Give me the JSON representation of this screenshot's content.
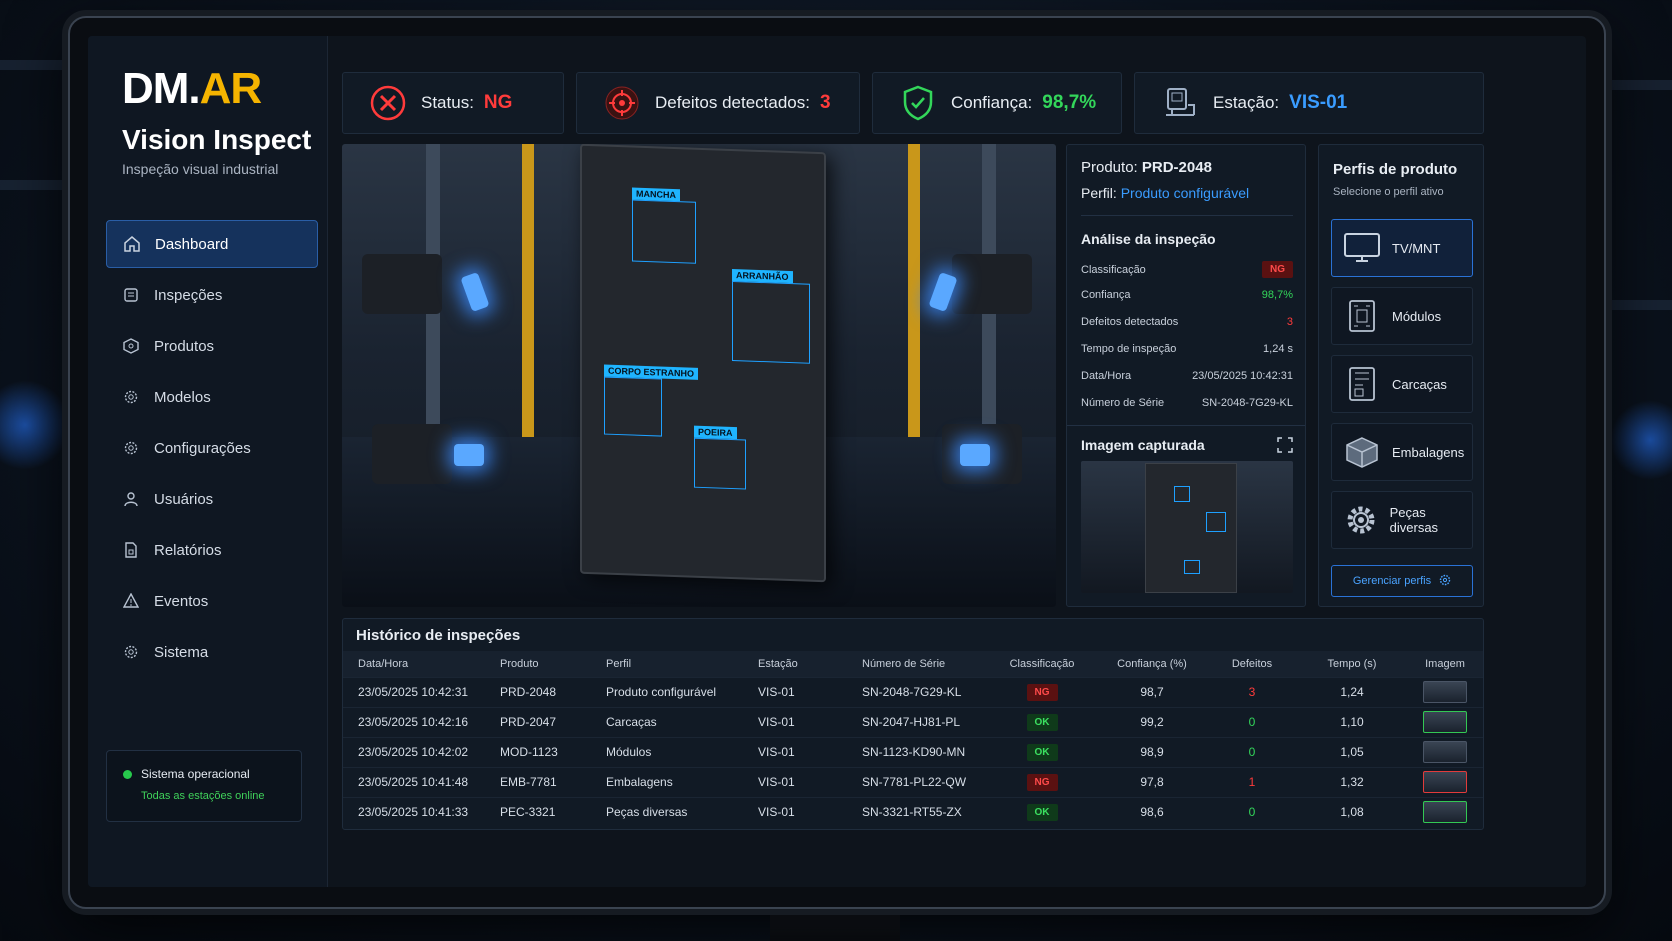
{
  "brand": {
    "logo_part1": "DM.",
    "logo_part2": "AR",
    "title": "Vision Inspect",
    "subtitle": "Inspeção visual industrial"
  },
  "sidebar": {
    "items": [
      {
        "label": "Dashboard",
        "icon": "home-icon",
        "active": true
      },
      {
        "label": "Inspeções",
        "icon": "clipboard-icon"
      },
      {
        "label": "Produtos",
        "icon": "box-icon"
      },
      {
        "label": "Modelos",
        "icon": "gear-icon"
      },
      {
        "label": "Configurações",
        "icon": "settings-icon"
      },
      {
        "label": "Usuários",
        "icon": "user-icon"
      },
      {
        "label": "Relatórios",
        "icon": "report-icon"
      },
      {
        "label": "Eventos",
        "icon": "warning-icon"
      },
      {
        "label": "Sistema",
        "icon": "system-gear-icon"
      }
    ],
    "system_status": {
      "title": "Sistema operacional",
      "subtitle": "Todas as estações online"
    }
  },
  "topbar": {
    "status": {
      "label": "Status:",
      "value": "NG"
    },
    "defects": {
      "label": "Defeitos detectados:",
      "value": "3"
    },
    "confidence": {
      "label": "Confiança:",
      "value": "98,7%"
    },
    "station": {
      "label": "Estação:",
      "value": "VIS-01"
    }
  },
  "inspection_image": {
    "defects": [
      "MANCHA",
      "ARRANHÃO",
      "CORPO ESTRANHO",
      "POEIRA"
    ]
  },
  "analysis": {
    "product_label": "Produto:",
    "product_value": "PRD-2048",
    "profile_label": "Perfil:",
    "profile_value": "Produto configurável",
    "section_title": "Análise da inspeção",
    "rows": [
      {
        "label": "Classificação",
        "value": "NG"
      },
      {
        "label": "Confiança",
        "value": "98,7%"
      },
      {
        "label": "Defeitos detectados",
        "value": "3"
      },
      {
        "label": "Tempo de inspeção",
        "value": "1,24 s"
      },
      {
        "label": "Data/Hora",
        "value": "23/05/2025 10:42:31"
      },
      {
        "label": "Número de Série",
        "value": "SN-2048-7G29-KL"
      }
    ],
    "captured_title": "Imagem capturada"
  },
  "profiles": {
    "title": "Perfis de produto",
    "subtitle": "Selecione o perfil ativo",
    "items": [
      {
        "label": "TV/MNT",
        "icon": "monitor-icon",
        "active": true
      },
      {
        "label": "Módulos",
        "icon": "circuit-icon"
      },
      {
        "label": "Carcaças",
        "icon": "chassis-icon"
      },
      {
        "label": "Embalagens",
        "icon": "package-icon"
      },
      {
        "label": "Peças diversas",
        "icon": "cog-icon"
      }
    ],
    "manage_label": "Gerenciar perfis"
  },
  "history": {
    "title": "Histórico de inspeções",
    "columns": [
      "Data/Hora",
      "Produto",
      "Perfil",
      "Estação",
      "Número de Série",
      "Classificação",
      "Confiança (%)",
      "Defeitos",
      "Tempo (s)",
      "Imagem"
    ],
    "rows": [
      {
        "datetime": "23/05/2025 10:42:31",
        "product": "PRD-2048",
        "profile": "Produto configurável",
        "station": "VIS-01",
        "serial": "SN-2048-7G29-KL",
        "class": "NG",
        "confidence": "98,7",
        "defects": "3",
        "time": "1,24"
      },
      {
        "datetime": "23/05/2025 10:42:16",
        "product": "PRD-2047",
        "profile": "Carcaças",
        "station": "VIS-01",
        "serial": "SN-2047-HJ81-PL",
        "class": "OK",
        "confidence": "99,2",
        "defects": "0",
        "time": "1,10"
      },
      {
        "datetime": "23/05/2025 10:42:02",
        "product": "MOD-1123",
        "profile": "Módulos",
        "station": "VIS-01",
        "serial": "SN-1123-KD90-MN",
        "class": "OK",
        "confidence": "98,9",
        "defects": "0",
        "time": "1,05"
      },
      {
        "datetime": "23/05/2025 10:41:48",
        "product": "EMB-7781",
        "profile": "Embalagens",
        "station": "VIS-01",
        "serial": "SN-7781-PL22-QW",
        "class": "NG",
        "confidence": "97,8",
        "defects": "1",
        "time": "1,32"
      },
      {
        "datetime": "23/05/2025 10:41:33",
        "product": "PEC-3321",
        "profile": "Peças diversas",
        "station": "VIS-01",
        "serial": "SN-3321-RT55-ZX",
        "class": "OK",
        "confidence": "98,6",
        "defects": "0",
        "time": "1,08"
      }
    ]
  },
  "colors": {
    "ng": "#ff3b3b",
    "ok": "#33d65a",
    "accent": "#3a9cff",
    "brand": "#f5b400"
  }
}
